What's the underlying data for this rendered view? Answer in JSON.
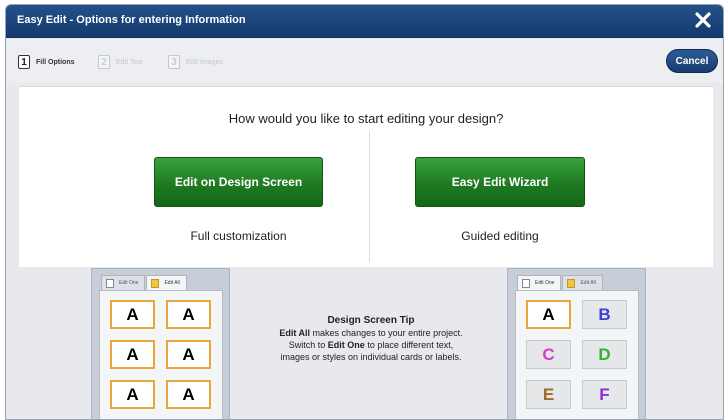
{
  "window": {
    "title": "Easy Edit - Options for entering Information"
  },
  "steps": [
    {
      "num": "1",
      "label": "Fill Options"
    },
    {
      "num": "2",
      "label": "Edit Text"
    },
    {
      "num": "3",
      "label": "Edit Images"
    }
  ],
  "cancel_label": "Cancel",
  "main": {
    "question": "How would you like to start editing your design?",
    "options": [
      {
        "button": "Edit on Design Screen",
        "caption": "Full customization"
      },
      {
        "button": "Easy Edit Wizard",
        "caption": "Guided editing"
      }
    ]
  },
  "tip": {
    "title": "Design Screen Tip",
    "line1_bold": "Edit All",
    "line1_rest": " makes changes to your entire project.",
    "line2_pre": "Switch to ",
    "line2_bold": "Edit One",
    "line2_rest": " to place different text,",
    "line3": "images or styles on individual cards or labels."
  },
  "preview_left": {
    "tabs": [
      "Edit One",
      "Edit All"
    ],
    "cells": [
      "A",
      "A",
      "A",
      "A",
      "A",
      "A"
    ]
  },
  "preview_right": {
    "tabs": [
      "Edit One",
      "Edit All"
    ],
    "cells": [
      "A",
      "B",
      "C",
      "D",
      "E",
      "F"
    ],
    "cell_colors": [
      "#000000",
      "#3f3fd6",
      "#d43ad4",
      "#2db52d",
      "#a06a2e",
      "#8a2fd6"
    ]
  },
  "colors": {
    "titlebar": "#1c467d",
    "primary_button": "#1f7a22",
    "selection": "#e9a43a"
  }
}
